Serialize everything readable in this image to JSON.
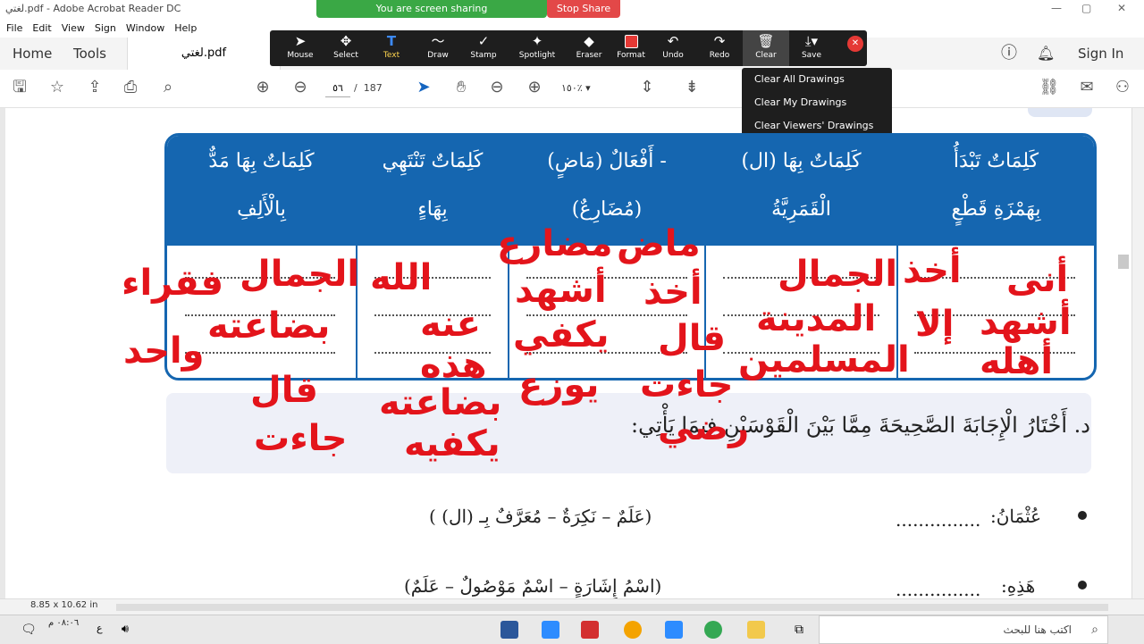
{
  "window": {
    "title": "لغتي.pdf - Adobe Acrobat Reader DC"
  },
  "share": {
    "banner": "You are screen sharing",
    "stop": "Stop Share"
  },
  "menu": [
    "File",
    "Edit",
    "View",
    "Sign",
    "Window",
    "Help"
  ],
  "tabs": {
    "home": "Home",
    "tools": "Tools",
    "file": "لغتي.pdf",
    "sign_in": "Sign In"
  },
  "toolbar": {
    "page_current": "٥٦",
    "page_sep": "/",
    "page_total": "187",
    "zoom": "١٥٠٪"
  },
  "annotation_tools": [
    {
      "label": "Mouse",
      "icon": "mouse-icon"
    },
    {
      "label": "Select",
      "icon": "move-icon"
    },
    {
      "label": "Text",
      "icon": "text-icon"
    },
    {
      "label": "Draw",
      "icon": "draw-icon"
    },
    {
      "label": "Stamp",
      "icon": "stamp-icon"
    },
    {
      "label": "Spotlight",
      "icon": "spotlight-icon"
    },
    {
      "label": "Eraser",
      "icon": "eraser-icon"
    },
    {
      "label": "Format",
      "icon": "format-icon"
    },
    {
      "label": "Undo",
      "icon": "undo-icon"
    },
    {
      "label": "Redo",
      "icon": "redo-icon"
    },
    {
      "label": "Clear",
      "icon": "trash-icon"
    },
    {
      "label": "Save",
      "icon": "save-icon"
    }
  ],
  "clear_menu": [
    "Clear All Drawings",
    "Clear My Drawings",
    "Clear Viewers' Drawings"
  ],
  "table": {
    "headers": [
      {
        "line1": "كَلِمَاتٌ تَبْدَأُ",
        "line2": "بِهَمْزَةِ قَطْعٍ"
      },
      {
        "line1": "كَلِمَاتٌ بِهَا (ال)",
        "line2": "الْقَمَرِيَّةُ"
      },
      {
        "line1": "أَفْعَالٌ (مَاضٍ) -",
        "line2": "(مُضَارِعٌ)"
      },
      {
        "line1": "كَلِمَاتٌ تَنْتَهِي",
        "line2": "بِهَاءٍ"
      },
      {
        "line1": "كَلِمَاتٌ بِهَا مَدٌّ",
        "line2": "بِالْأَلِفِ"
      }
    ]
  },
  "handwriting": {
    "col1": [
      "أنى",
      "أشهد",
      "أهله",
      "أخذ",
      "إلا"
    ],
    "col2": [
      "الجمال",
      "المدينة",
      "المسلمين"
    ],
    "col3": [
      "ماض",
      "مضارع",
      "أخذ",
      "أشهد",
      "قال",
      "يكفي",
      "جاءت",
      "يوزع",
      "رضي"
    ],
    "col4": [
      "الله",
      "عنه",
      "هذه",
      "بضاعته",
      "يكفيه"
    ],
    "col5": [
      "الجمال",
      "فقراء",
      "بضاعته",
      "واحد",
      "قال",
      "جاءت"
    ]
  },
  "section": {
    "heading": "د. أَخْتَارُ الْإِجَابَةَ الصَّحِيحَةَ مِمَّا بَيْنَ الْقَوْسَيْنِ فِيمَا يَأْتِي:"
  },
  "questions": [
    {
      "word": "عُثْمَانُ:",
      "dots": "...............",
      "options": "(عَلَمٌ – نَكِرَةٌ – مُعَرَّفٌ بِـ (ال) )"
    },
    {
      "word": "هَذِهِ:",
      "dots": "...............",
      "options": "(اسْمُ إِشَارَةٍ – اسْمٌ مَوْصُولٌ – عَلَمٌ)"
    }
  ],
  "status": {
    "page_size": "8.85 x 10.62 in"
  },
  "taskbar": {
    "search_placeholder": "اكتب هنا للبحث",
    "time": "٠٨:٠٦ م",
    "lang": "ع"
  }
}
